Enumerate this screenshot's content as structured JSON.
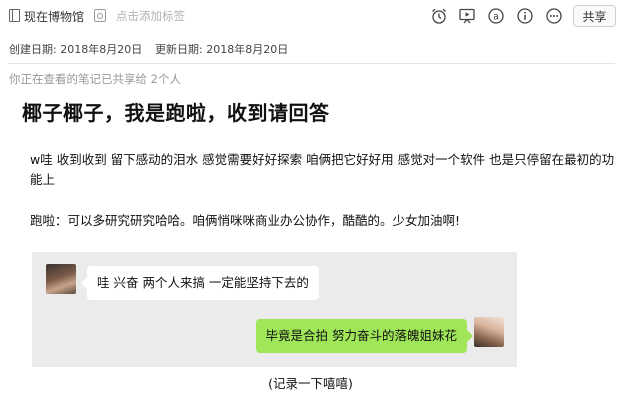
{
  "toolbar": {
    "notebook_icon": "notebook-icon",
    "notebook_name": "现在博物馆",
    "tag_icon": "tag-icon",
    "tag_placeholder": "点击添加标签",
    "icons": [
      "alarm-clock-icon",
      "presentation-icon",
      "at-sign-icon",
      "info-icon",
      "more-icon"
    ],
    "share_label": "共享"
  },
  "meta": {
    "created": "创建日期: 2018年8月20日",
    "updated": "更新日期: 2018年8月20日"
  },
  "shared_notice": "你正在查看的笔记已共享给 2个人",
  "note": {
    "title": "椰子椰子，我是跑啦，收到请回答",
    "paragraph1": "w哇 收到收到 留下感动的泪水 感觉需要好好探索  咱俩把它好好用 感觉对一个软件 也是只停留在最初的功能上",
    "paragraph2": "跑啦：可以多研究研究哈哈。咱俩悄咪咪商业办公协作，酷酷的。少女加油啊!"
  },
  "chat": {
    "messages": [
      {
        "side": "left",
        "text": "哇 兴奋 两个人来搞 一定能坚持下去的"
      },
      {
        "side": "right",
        "text": "毕竟是合拍 努力奋斗的落魄姐妹花"
      }
    ],
    "left_bubble_color": "#ffffff",
    "right_bubble_color": "#9fe658",
    "background_color": "#ebebeb"
  },
  "caption": "(记录一下嘻嘻)"
}
